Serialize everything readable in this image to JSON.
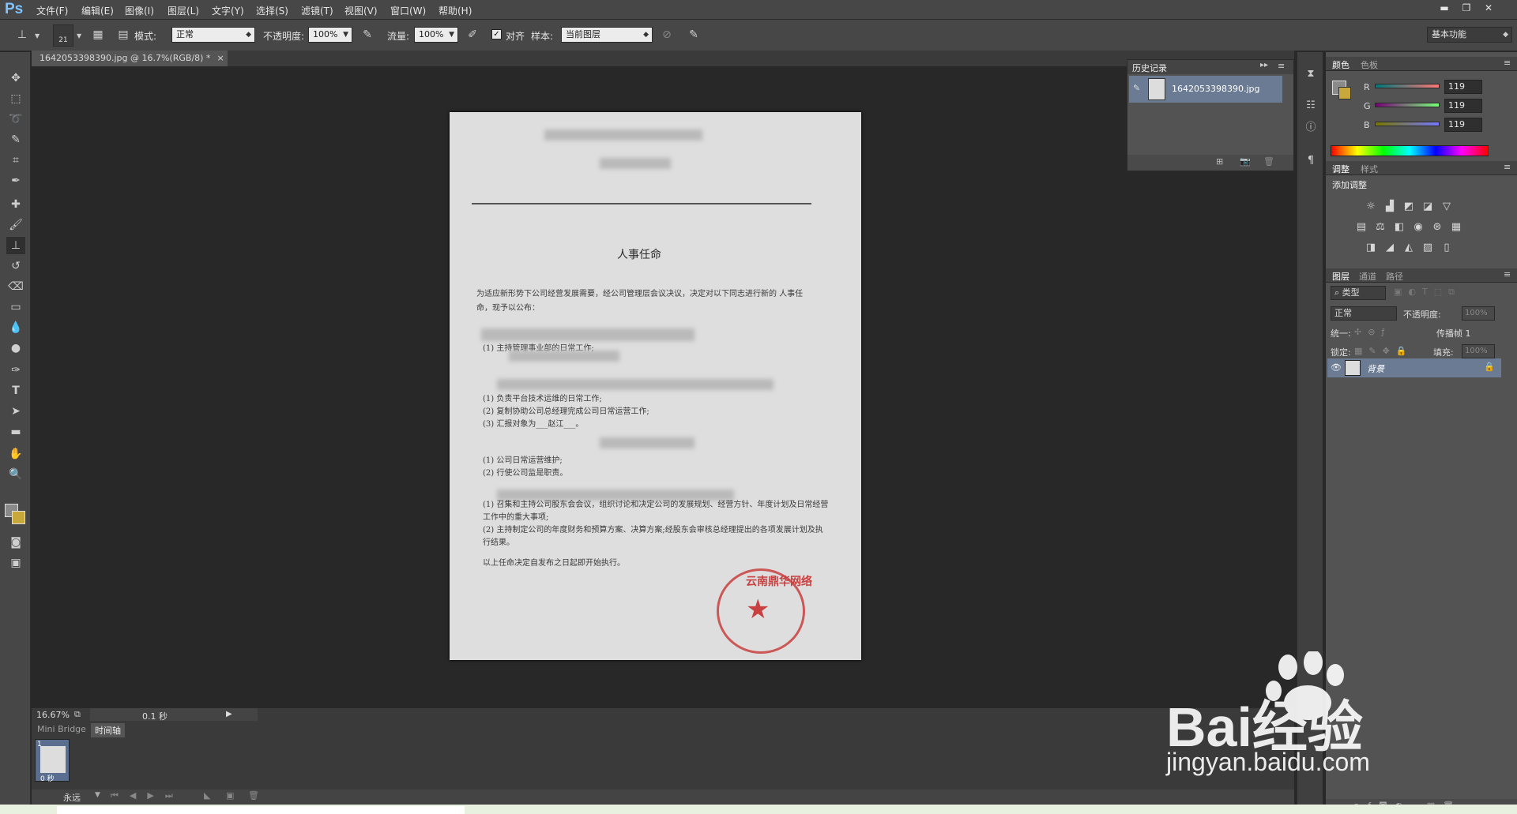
{
  "app": {
    "logo": "Ps"
  },
  "menus": [
    "文件(F)",
    "编辑(E)",
    "图像(I)",
    "图层(L)",
    "文字(Y)",
    "选择(S)",
    "滤镜(T)",
    "视图(V)",
    "窗口(W)",
    "帮助(H)"
  ],
  "window_buttons": [
    "minimize",
    "restore",
    "close"
  ],
  "options": {
    "brush_size": "21",
    "mode_label": "模式:",
    "mode_value": "正常",
    "opacity_label": "不透明度:",
    "opacity_value": "100%",
    "flow_label": "流量:",
    "flow_value": "100%",
    "align_label": "对齐",
    "align_checked": true,
    "sample_label": "样本:",
    "sample_value": "当前图层",
    "workspace": "基本功能"
  },
  "tools": [
    "move-tool",
    "marquee-tool",
    "lasso-tool",
    "quick-select-tool",
    "crop-tool",
    "eyedropper-tool",
    "spot-heal-tool",
    "brush-tool",
    "clone-stamp-tool",
    "history-brush-tool",
    "eraser-tool",
    "gradient-tool",
    "blur-tool",
    "dodge-tool",
    "pen-tool",
    "type-tool",
    "path-select-tool",
    "shape-tool",
    "hand-tool",
    "zoom-tool"
  ],
  "document": {
    "tab_title": "1642053398390.jpg @ 16.7%(RGB/8) *",
    "title": "人事任命",
    "intro": "为适应新形势下公司经营发展需要，经公司管理层会议决议，决定对以下同志进行新的 人事任命，现予以公布：",
    "lines": [
      "(1)   主持管理事业部的日常工作;",
      "(1)    负责平台技术运维的日常工作;",
      "(2)    复制协助公司总经理完成公司日常运营工作;",
      "(3)    汇报对象为___赵江___。",
      "(1)    公司日常运营维护;",
      "(2)    行使公司监是职责。",
      "(1) 召集和主持公司股东会会议，组织讨论和决定公司的发展规划、经营方针、年度计划及日常经营工作中的重大事项;",
      "(2) 主持制定公司的年度财务和预算方案、决算方案;经股东会审核总经理提出的各项发展计划及执行结果。",
      "以上任命决定自发布之日起即开始执行。"
    ],
    "stamp_text": "云南鼎华网络"
  },
  "status": {
    "zoom": "16.67%",
    "time": "0.1 秒"
  },
  "bottom": {
    "tabs": [
      "Mini Bridge",
      "时间轴"
    ],
    "frame_num": "1",
    "frame_time": "0 秒",
    "loop": "永远"
  },
  "history": {
    "title": "历史记录",
    "item": "1642053398390.jpg"
  },
  "color": {
    "tabs": [
      "颜色",
      "色板"
    ],
    "r_label": "R",
    "g_label": "G",
    "b_label": "B",
    "r": "119",
    "g": "119",
    "b": "119"
  },
  "adjust": {
    "tabs": [
      "调整",
      "样式"
    ],
    "add_label": "添加调整"
  },
  "layers": {
    "tabs": [
      "图层",
      "通道",
      "路径"
    ],
    "kind": "类型",
    "blend": "正常",
    "opacity_label": "不透明度:",
    "opacity_value": "100%",
    "unify_label": "统一:",
    "propagate_label": "传播帧 1",
    "lock_label": "锁定:",
    "fill_label": "填充:",
    "fill_value": "100%",
    "layer_name": "背景"
  },
  "watermark": {
    "line1": "Bai经验",
    "line2": "jingyan.baidu.com"
  },
  "colors": {
    "accent_arrow": "#e03030",
    "highlight": "#6a7b93",
    "foreground": "#8a8a8a",
    "background": "#c8a83a"
  }
}
